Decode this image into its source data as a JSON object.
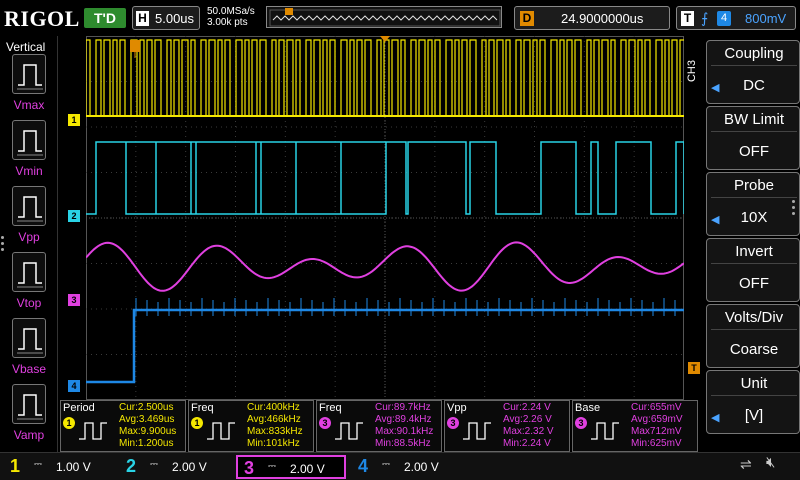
{
  "top": {
    "brand": "RIGOL",
    "run_state": "T'D",
    "horizontal": {
      "key": "H",
      "value": "5.00us"
    },
    "sample_rate": "50.0MSa/s",
    "memory_depth": "3.00k pts",
    "delay": {
      "key": "D",
      "value": "24.9000000us"
    },
    "trigger": {
      "key": "T",
      "edge": "rising-edge-icon",
      "source": "4",
      "level": "800mV"
    }
  },
  "left_menu": {
    "title": "Vertical",
    "items": [
      {
        "label": "Vmax",
        "icon": "vmax-icon"
      },
      {
        "label": "Vmin",
        "icon": "vmin-icon"
      },
      {
        "label": "Vpp",
        "icon": "vpp-icon"
      },
      {
        "label": "Vtop",
        "icon": "vtop-icon"
      },
      {
        "label": "Vbase",
        "icon": "vbase-icon"
      },
      {
        "label": "Vamp",
        "icon": "vamp-icon"
      }
    ]
  },
  "right_menu": {
    "channel_tab": "CH3",
    "items": [
      {
        "title": "Coupling",
        "value": "DC"
      },
      {
        "title": "BW Limit",
        "value": "OFF"
      },
      {
        "title": "Probe",
        "value": "10X"
      },
      {
        "title": "Invert",
        "value": "OFF"
      },
      {
        "title": "Volts/Div",
        "value": "Coarse"
      },
      {
        "title": "Unit",
        "value": "[V]"
      }
    ]
  },
  "markers": {
    "ch1": "1",
    "ch2": "2",
    "ch3": "3",
    "ch4": "4",
    "trigger": "T"
  },
  "measurements": [
    {
      "name": "Period",
      "channel": "1",
      "color": "#f5e800",
      "cur": "Cur:2.500us",
      "avg": "Avg:3.469us",
      "max": "Max:9.900us",
      "min": "Min:1.200us"
    },
    {
      "name": "Freq",
      "channel": "1",
      "color": "#f5e800",
      "cur": "Cur:400kHz",
      "avg": "Avg:466kHz",
      "max": "Max:833kHz",
      "min": "Min:101kHz"
    },
    {
      "name": "Freq",
      "channel": "3",
      "color": "#e040e0",
      "cur": "Cur:89.7kHz",
      "avg": "Avg:89.4kHz",
      "max": "Max:90.1kHz",
      "min": "Min:88.5kHz"
    },
    {
      "name": "Vpp",
      "channel": "3",
      "color": "#e040e0",
      "cur": "Cur:2.24 V",
      "avg": "Avg:2.26 V",
      "max": "Max:2.32 V",
      "min": "Min:2.24 V"
    },
    {
      "name": "Base",
      "channel": "3",
      "color": "#e040e0",
      "cur": "Cur:655mV",
      "avg": "Avg:659mV",
      "max": "Max712mV",
      "min": "Min:625mV"
    }
  ],
  "channels": [
    {
      "num": "1",
      "coupling": "DC",
      "scale": "1.00 V",
      "color": "#f5e800",
      "active": false
    },
    {
      "num": "2",
      "coupling": "DC",
      "scale": "2.00 V",
      "color": "#29d3e6",
      "active": false
    },
    {
      "num": "3",
      "coupling": "DC",
      "scale": "2.00 V",
      "color": "#e040e0",
      "active": true
    },
    {
      "num": "4",
      "coupling": "DC",
      "scale": "2.00 V",
      "color": "#1e88e5",
      "active": false
    }
  ],
  "colors": {
    "ch1": "#f5e800",
    "ch2": "#29d3e6",
    "ch3": "#e040e0",
    "ch4": "#1e88e5",
    "trigger": "#e08a00",
    "grid": "#3a3a3a"
  },
  "status": {
    "usb": "usb-icon",
    "sound": "speaker-muted-icon"
  }
}
